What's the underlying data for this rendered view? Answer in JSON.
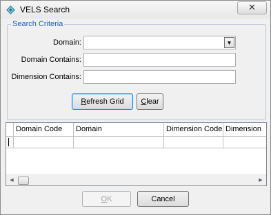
{
  "window": {
    "title": "VELS Search",
    "close_glyph": "✕"
  },
  "criteria": {
    "legend": "Search Criteria",
    "domain_label": "Domain:",
    "domain_value": "",
    "domain_contains_label": "Domain Contains:",
    "domain_contains_value": "",
    "dimension_contains_label": "Dimension Contains:",
    "dimension_contains_value": ""
  },
  "buttons": {
    "refresh_mnemonic": "R",
    "refresh_rest": "efresh Grid",
    "clear_mnemonic": "C",
    "clear_rest": "lear",
    "ok_mnemonic": "O",
    "ok_rest": "K",
    "cancel": "Cancel"
  },
  "grid": {
    "columns": [
      "Domain Code",
      "Domain",
      "Dimension Code",
      "Dimension"
    ],
    "rows": [
      [
        "",
        "",
        "",
        ""
      ]
    ]
  },
  "colors": {
    "legend": "#1c5ac8",
    "dialog_bg": "#f0f0f0"
  }
}
